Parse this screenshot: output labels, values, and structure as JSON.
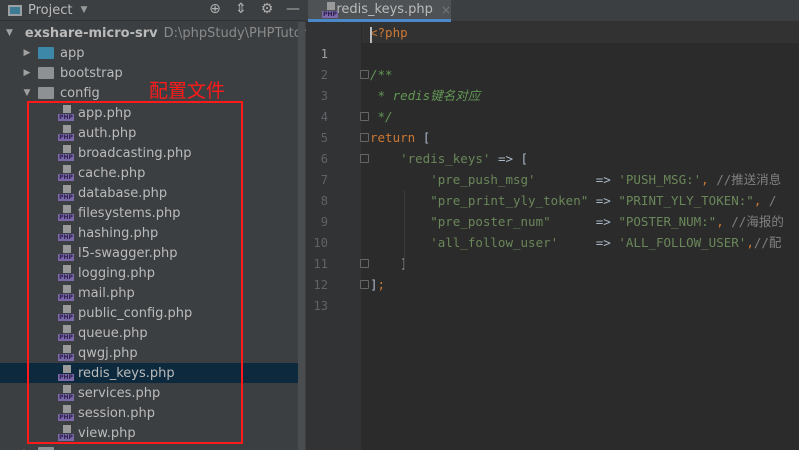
{
  "panel": {
    "title": "Project",
    "icons": [
      "target-icon",
      "collapse-icon",
      "gear-icon",
      "minimize-icon"
    ]
  },
  "tree": [
    {
      "label": "exshare-micro-srv",
      "path": "D:\\phpStudy\\PHPTutorial\\W",
      "type": "root"
    },
    {
      "label": "app",
      "type": "folder",
      "color": "blue"
    },
    {
      "label": "bootstrap",
      "type": "folder"
    },
    {
      "label": "config",
      "type": "folder-open"
    },
    {
      "label": "app.php",
      "type": "file"
    },
    {
      "label": "auth.php",
      "type": "file"
    },
    {
      "label": "broadcasting.php",
      "type": "file"
    },
    {
      "label": "cache.php",
      "type": "file"
    },
    {
      "label": "database.php",
      "type": "file"
    },
    {
      "label": "filesystems.php",
      "type": "file"
    },
    {
      "label": "hashing.php",
      "type": "file"
    },
    {
      "label": "l5-swagger.php",
      "type": "file"
    },
    {
      "label": "logging.php",
      "type": "file"
    },
    {
      "label": "mail.php",
      "type": "file"
    },
    {
      "label": "public_config.php",
      "type": "file"
    },
    {
      "label": "queue.php",
      "type": "file"
    },
    {
      "label": "qwgj.php",
      "type": "file"
    },
    {
      "label": "redis_keys.php",
      "type": "file",
      "selected": true
    },
    {
      "label": "services.php",
      "type": "file"
    },
    {
      "label": "session.php",
      "type": "file"
    },
    {
      "label": "view.php",
      "type": "file"
    }
  ],
  "annotation": "配置文件",
  "tab": {
    "label": "redis_keys.php",
    "close": "×"
  },
  "code": [
    [
      [
        "tag",
        "<?php"
      ]
    ],
    [],
    [
      [
        "d",
        "/**"
      ]
    ],
    [
      [
        "d",
        " * redis键名对应"
      ]
    ],
    [
      [
        "d",
        " */"
      ]
    ],
    [
      [
        "k",
        "return "
      ],
      [
        "p",
        "["
      ]
    ],
    [
      [
        "s",
        "    'redis_keys'"
      ],
      [
        "p",
        " => ["
      ]
    ],
    [
      [
        "s",
        "        'pre_push_msg'"
      ],
      [
        "p",
        "        => "
      ],
      [
        "s",
        "'PUSH_MSG:'"
      ],
      [
        "k",
        ", "
      ],
      [
        "c",
        "//推送消息"
      ]
    ],
    [
      [
        "s",
        "        \"pre_print_yly_token\""
      ],
      [
        "p",
        " => "
      ],
      [
        "s",
        "\"PRINT_YLY_TOKEN:\""
      ],
      [
        "k",
        ", "
      ],
      [
        "c",
        "/"
      ]
    ],
    [
      [
        "s",
        "        \"pre_poster_num\""
      ],
      [
        "p",
        "      => "
      ],
      [
        "s",
        "\"POSTER_NUM:\""
      ],
      [
        "k",
        ", "
      ],
      [
        "c",
        "//海报的"
      ]
    ],
    [
      [
        "s",
        "        'all_follow_user'"
      ],
      [
        "p",
        "     => "
      ],
      [
        "s",
        "'ALL_FOLLOW_USER'"
      ],
      [
        "k",
        ","
      ],
      [
        "c",
        "//配"
      ]
    ],
    [
      [
        "p",
        "    ]"
      ]
    ],
    [
      [
        "p",
        "]"
      ],
      [
        "k",
        ";"
      ]
    ]
  ]
}
